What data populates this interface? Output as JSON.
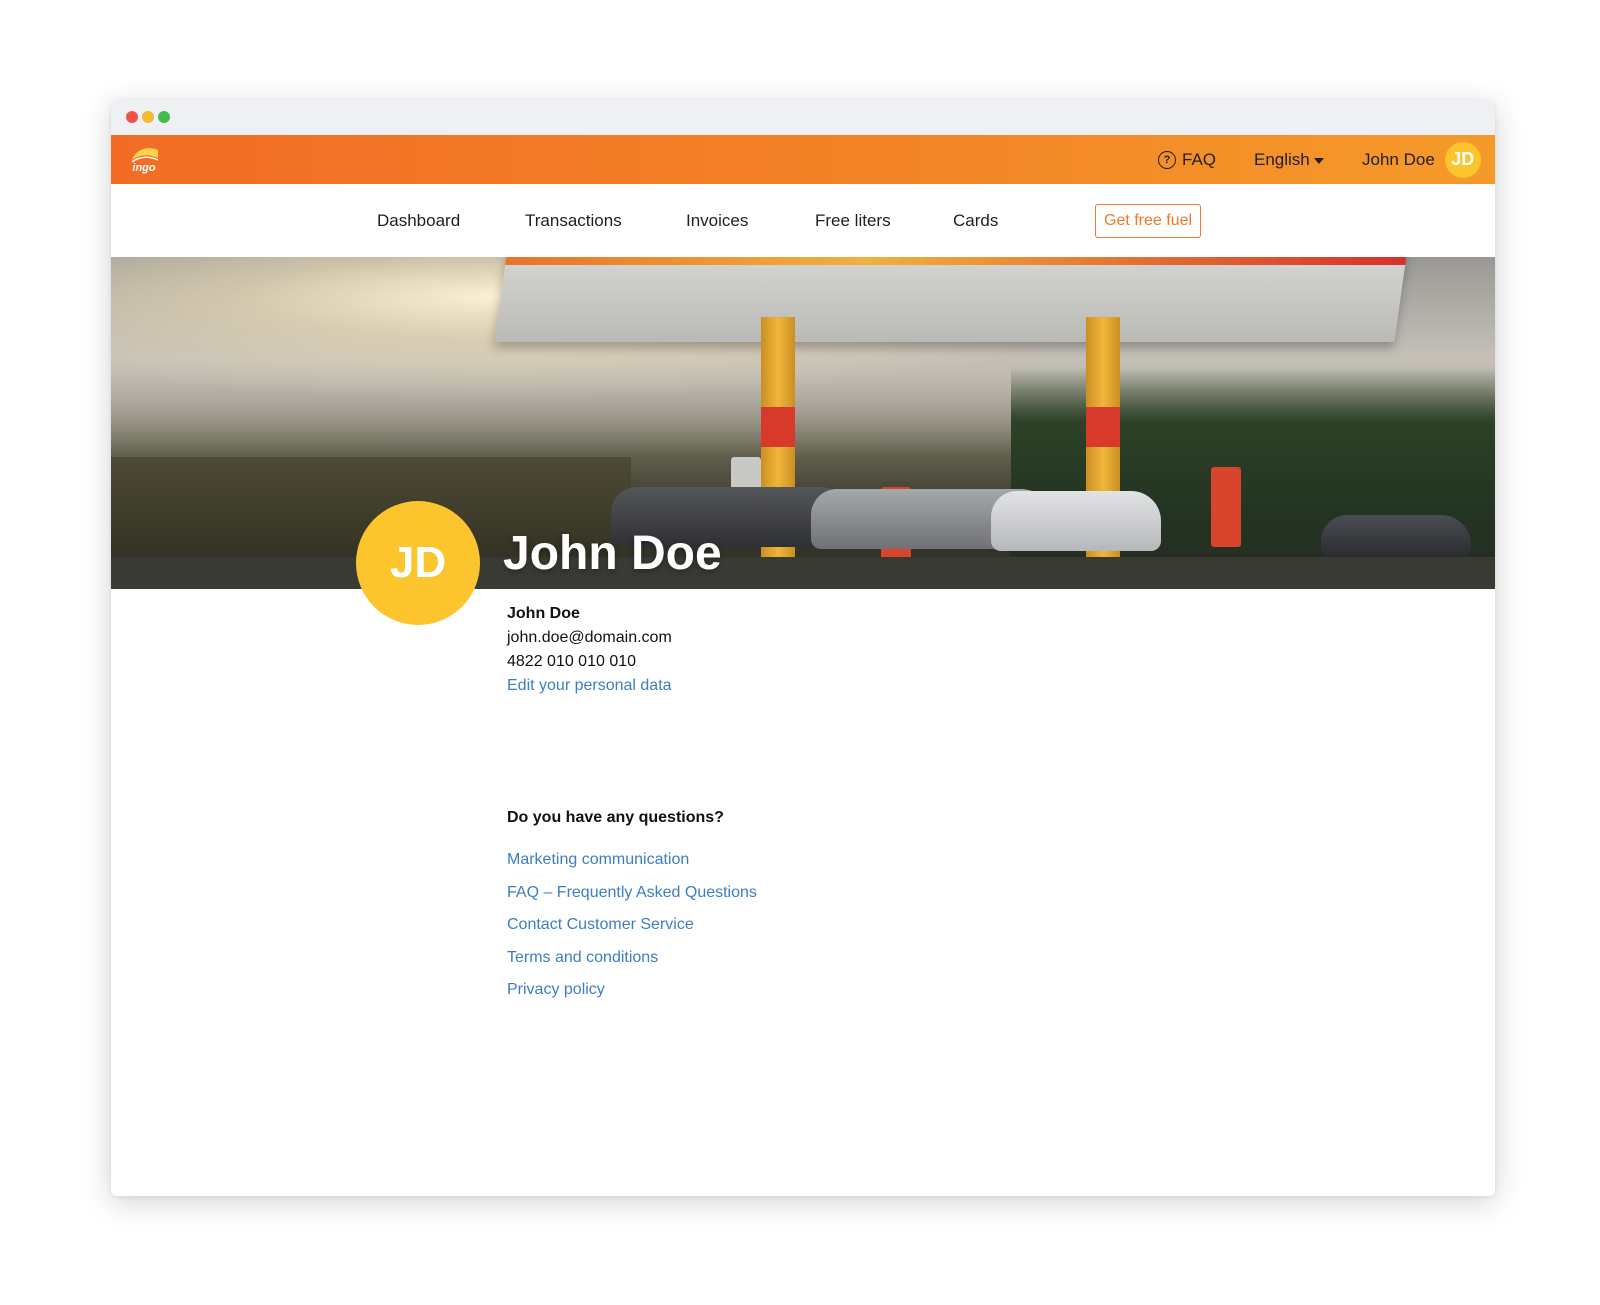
{
  "topbar": {
    "logo_text": "ingo",
    "faq_icon_glyph": "?",
    "faq_label": "FAQ",
    "language_label": "English",
    "user_name": "John Doe",
    "user_initials": "JD",
    "accent_color": "#f26c25"
  },
  "nav": {
    "items": [
      {
        "label": "Dashboard"
      },
      {
        "label": "Transactions"
      },
      {
        "label": "Invoices"
      },
      {
        "label": "Free liters"
      },
      {
        "label": "Cards"
      }
    ],
    "cta_label": "Get free fuel"
  },
  "hero": {
    "title": "John Doe",
    "avatar_initials": "JD",
    "avatar_color": "#fcc52e"
  },
  "profile": {
    "name": "John Doe",
    "email": "john.doe@domain.com",
    "phone": "4822 010 010 010",
    "edit_link": "Edit your personal data"
  },
  "questions": {
    "title": "Do you have any questions?",
    "links": [
      {
        "label": "Marketing communication"
      },
      {
        "label": "FAQ – Frequently Asked Questions"
      },
      {
        "label": "Contact Customer Service"
      },
      {
        "label": "Terms and conditions"
      },
      {
        "label": "Privacy policy"
      }
    ],
    "link_color": "#3b7ec4"
  }
}
